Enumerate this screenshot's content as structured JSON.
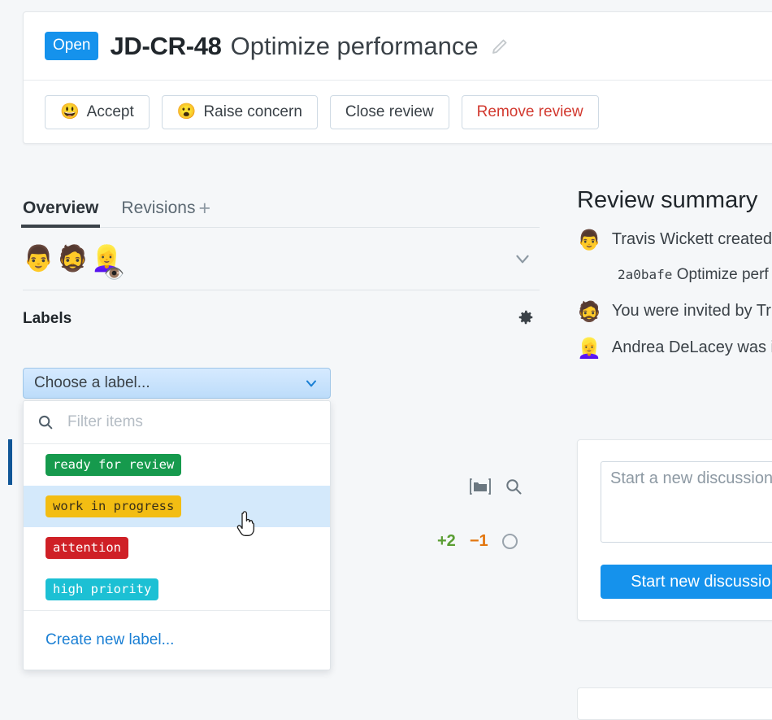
{
  "header": {
    "status_badge": "Open",
    "issue_key": "JD-CR-48",
    "issue_title": "Optimize performance",
    "edit_icon": "pencil-icon",
    "actions": [
      {
        "label": "Accept",
        "emoji": "😃",
        "emoji_name": "green-smiling-face-icon",
        "style": "default"
      },
      {
        "label": "Raise concern",
        "emoji": "😮",
        "emoji_name": "purple-concerned-face-icon",
        "style": "default"
      },
      {
        "label": "Close review",
        "emoji": "",
        "emoji_name": "",
        "style": "default"
      },
      {
        "label": "Remove review",
        "emoji": "",
        "emoji_name": "",
        "style": "danger"
      }
    ]
  },
  "left": {
    "tabs": [
      {
        "label": "Overview",
        "active": true
      },
      {
        "label": "Revisions",
        "active": false
      }
    ],
    "add_revision": "+",
    "participants": [
      {
        "emoji": "👨",
        "name": "participant-travis-wickett",
        "badge": ""
      },
      {
        "emoji": "🧔",
        "name": "participant-bearded-reviewer",
        "badge": ""
      },
      {
        "emoji": "👱‍♀️",
        "name": "participant-andrea-delacey",
        "badge": "👁️"
      }
    ],
    "labels_heading": "Labels",
    "labels_gear": "gear-icon",
    "label_select_value": "Choose a label...",
    "label_filter_placeholder": "Filter items",
    "label_options": [
      {
        "text": "ready for review",
        "bg": "#169a4d",
        "fg": "#ffffff",
        "highlighted": false
      },
      {
        "text": "work in progress",
        "bg": "#f3bd13",
        "fg": "#3a3019",
        "highlighted": true
      },
      {
        "text": "attention",
        "bg": "#cf2026",
        "fg": "#ffffff",
        "highlighted": false
      },
      {
        "text": "high priority",
        "bg": "#1cc0d4",
        "fg": "#ffffff",
        "highlighted": false
      }
    ],
    "create_label_link": "Create new label..."
  },
  "diff": {
    "folder_icon": "folder-brackets-icon",
    "search_icon": "search-icon",
    "additions": "+2",
    "deletions": "−1",
    "status_circle": "empty-circle-icon"
  },
  "right": {
    "heading": "Review summary",
    "rows": [
      {
        "avatar": "👨",
        "avatar_name": "avatar-travis-wickett",
        "text": "Travis Wickett created",
        "sub_hash": "2a0bafe",
        "sub_text": "Optimize perf"
      },
      {
        "avatar": "🧔",
        "avatar_name": "avatar-bearded-reviewer",
        "text": "You were invited by Tr",
        "sub_hash": "",
        "sub_text": ""
      },
      {
        "avatar": "👱‍♀️",
        "avatar_name": "avatar-andrea-delacey",
        "text": "Andrea DeLacey was i",
        "sub_hash": "",
        "sub_text": ""
      }
    ],
    "discussion_placeholder": "Start a new discussion.",
    "discussion_value": "",
    "start_discussion_label": "Start new discussion"
  },
  "colors": {
    "accent_blue": "#1592ec",
    "danger_red": "#d2392f",
    "link_blue": "#1a7fd4",
    "additions_green": "#5a9e33",
    "deletions_orange": "#e2760f",
    "highlight_blue": "#d4e9fb",
    "page_bg": "#f5f7f9",
    "accent_bar": "#105697"
  }
}
